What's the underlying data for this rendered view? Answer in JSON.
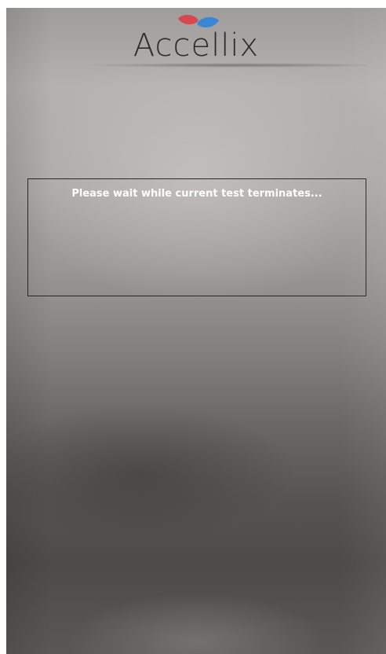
{
  "brand": {
    "name": "Accellix",
    "mark_icon": "accellix-logo-icon",
    "colors": {
      "red": "#d8474f",
      "blue": "#3a86d4"
    }
  },
  "status": {
    "message": "Please wait while current test terminates..."
  },
  "theme": {
    "text": "#ffffff",
    "border": "#2a2828"
  }
}
